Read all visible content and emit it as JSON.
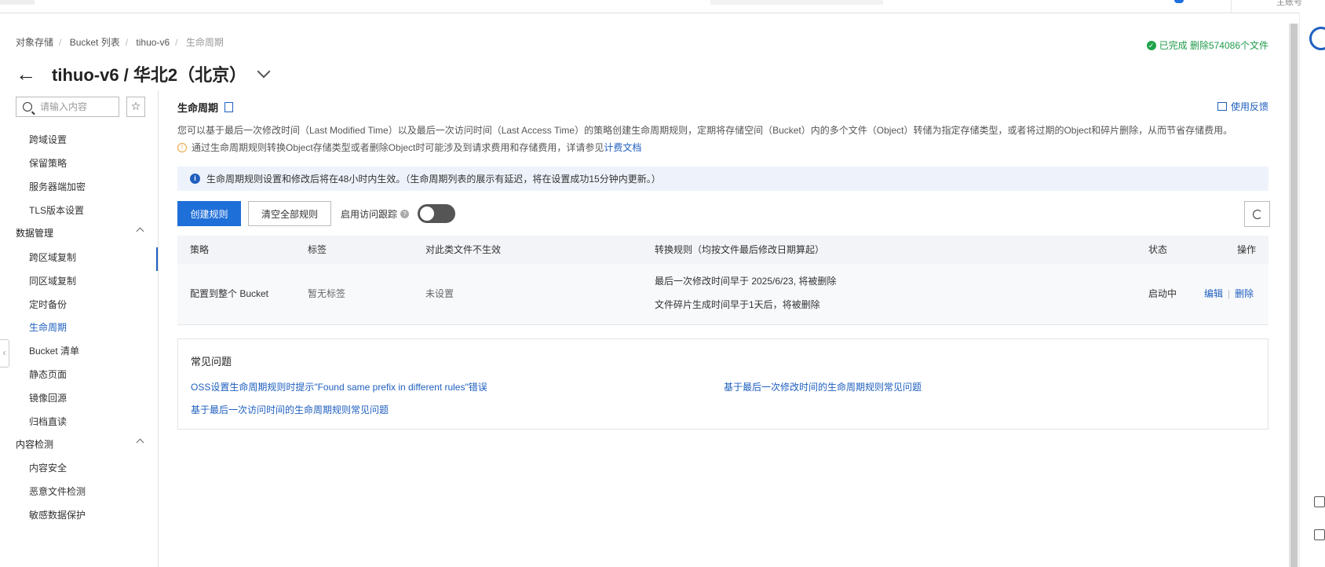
{
  "header": {
    "account_label": "主账号"
  },
  "breadcrumb": [
    "对象存储",
    "Bucket 列表",
    "tihuo-v6",
    "生命周期"
  ],
  "status": {
    "text": "已完成 删除574086个文件"
  },
  "page": {
    "title": "tihuo-v6 / 华北2（北京）"
  },
  "sidebar": {
    "search_placeholder": "请输入内容",
    "items": [
      {
        "label": "跨域设置"
      },
      {
        "label": "保留策略"
      },
      {
        "label": "服务器端加密"
      },
      {
        "label": "TLS版本设置"
      }
    ],
    "groups": [
      {
        "label": "数据管理",
        "items": [
          "跨区域复制",
          "同区域复制",
          "定时备份",
          "生命周期",
          "Bucket 清单",
          "静态页面",
          "镜像回源",
          "归档直读"
        ]
      },
      {
        "label": "内容检测",
        "items": [
          "内容安全",
          "恶意文件检测",
          "敏感数据保护"
        ]
      }
    ],
    "active": "生命周期"
  },
  "section": {
    "title": "生命周期",
    "feedback": "使用反馈",
    "description": "您可以基于最后一次修改时间（Last Modified Time）以及最后一次访问时间（Last Access Time）的策略创建生命周期规则，定期将存储空间（Bucket）内的多个文件（Object）转储为指定存储类型，或者将过期的Object和碎片删除，从而节省存储费用。",
    "warning_text": "通过生命周期规则转换Object存储类型或者删除Object时可能涉及到请求费用和存储费用，详请参见",
    "warning_link": "计费文档",
    "info": "生命周期规则设置和修改后将在48小时内生效。（生命周期列表的展示有延迟，将在设置成功15分钟内更新。）"
  },
  "toolbar": {
    "create_label": "创建规则",
    "clear_label": "清空全部规则",
    "tracking_label": "启用访问跟踪",
    "tracking_enabled": false
  },
  "table": {
    "headers": [
      "策略",
      "标签",
      "对此类文件不生效",
      "转换规则（均按文件最后修改日期算起）",
      "状态",
      "操作"
    ],
    "rows": [
      {
        "policy": "配置到整个 Bucket",
        "tags": "暂无标签",
        "exclude": "未设置",
        "rule1": "最后一次修改时间早于 2025/6/23, 将被删除",
        "rule2": "文件碎片生成时间早于1天后，将被删除",
        "status": "启动中",
        "edit": "编辑",
        "delete": "删除"
      }
    ]
  },
  "faq": {
    "title": "常见问题",
    "links": [
      "OSS设置生命周期规则时提示\"Found same prefix in different rules\"错误",
      "基于最后一次修改时间的生命周期规则常见问题",
      "基于最后一次访问时间的生命周期规则常见问题"
    ]
  }
}
